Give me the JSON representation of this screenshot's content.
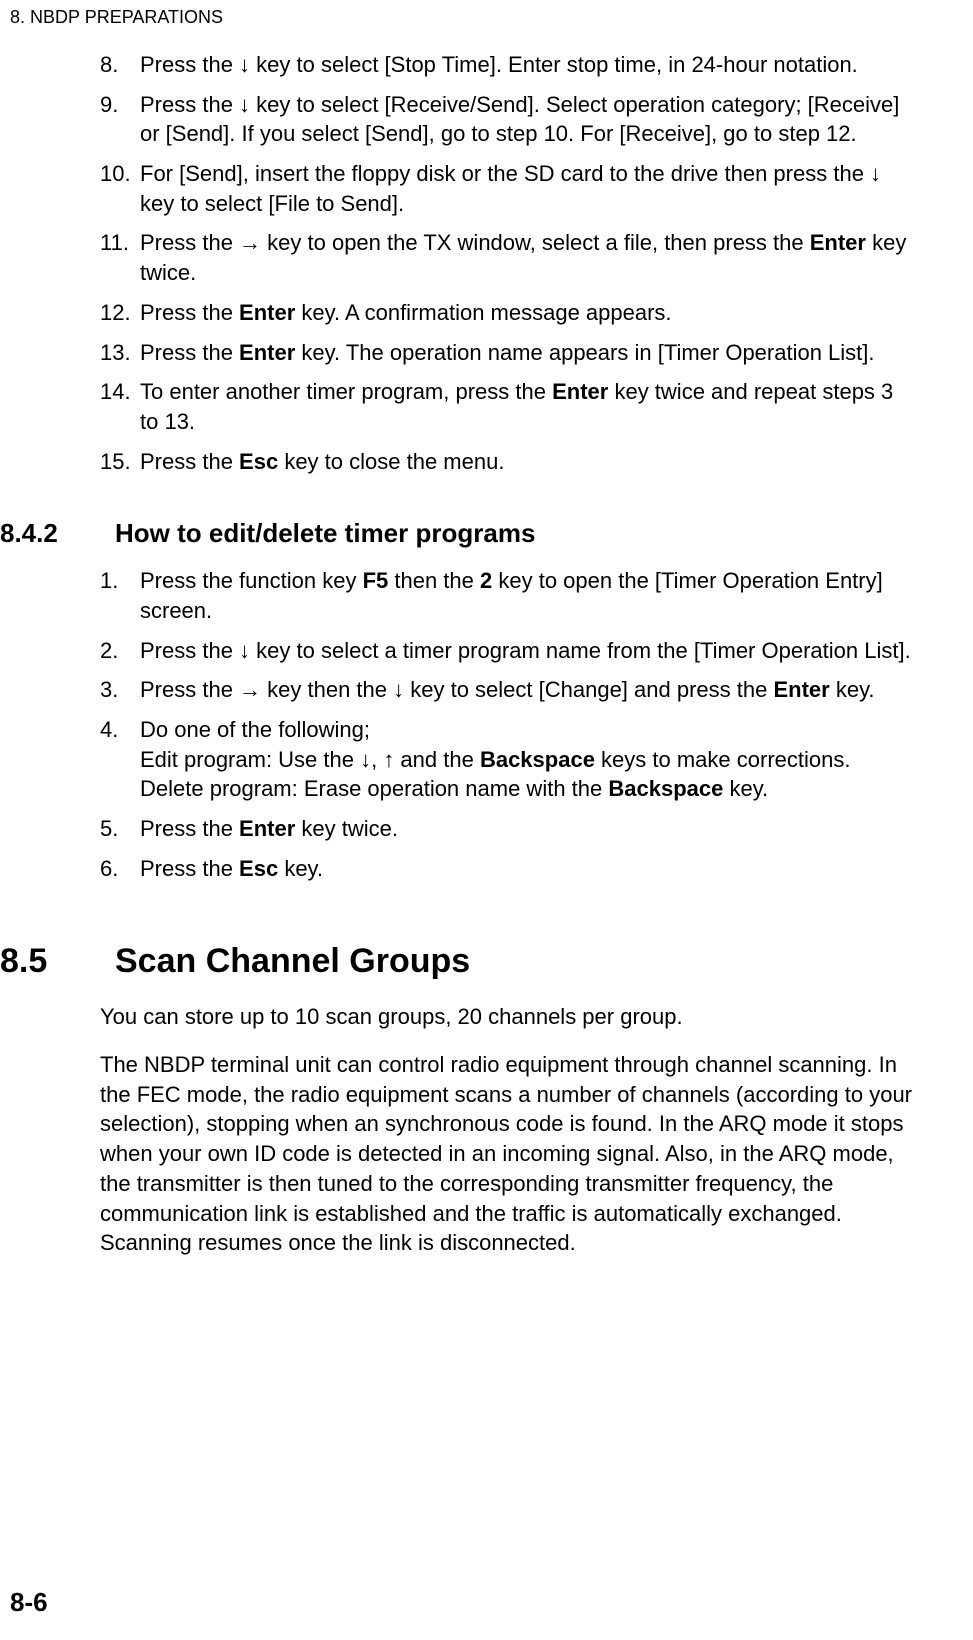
{
  "header": "8.  NBDP PREPARATIONS",
  "page_number": "8-6",
  "list1": {
    "items": [
      {
        "num": "8.",
        "html": "Press the ↓ key to select [Stop Time]. Enter stop time, in 24-hour notation."
      },
      {
        "num": "9.",
        "html": "Press the ↓ key to select [Receive/Send]. Select operation category; [Receive] or [Send]. If you select [Send], go to step 10. For [Receive], go to step 12."
      },
      {
        "num": "10.",
        "html": "For [Send], insert the floppy disk or the SD card to the drive then press the ↓ key to select [File to Send]."
      },
      {
        "num": "11.",
        "html": "Press the → key to open the TX window, select a file, then press the <b>Enter</b> key twice."
      },
      {
        "num": "12.",
        "html": "Press the <b>Enter</b> key. A confirmation message appears."
      },
      {
        "num": "13.",
        "html": "Press the <b>Enter</b> key. The operation name appears in [Timer Operation List]."
      },
      {
        "num": "14.",
        "html": "To enter another timer program, press the <b>Enter</b> key twice and repeat steps 3 to 13."
      },
      {
        "num": "15.",
        "html": "Press the <b>Esc</b> key to close the menu."
      }
    ]
  },
  "section842": {
    "num": "8.4.2",
    "title": "How to edit/delete timer programs",
    "items": [
      {
        "num": "1.",
        "html": "Press the function key <b>F5</b> then the <b>2</b> key to open the [Timer Operation Entry] screen."
      },
      {
        "num": "2.",
        "html": "Press the ↓ key to select a timer program name from the [Timer Operation List]."
      },
      {
        "num": "3.",
        "html": "Press the → key then the ↓ key to select [Change] and press the <b>Enter</b> key."
      },
      {
        "num": "4.",
        "html": "Do one of the following;<br>Edit program: Use the ↓, ↑ and the <b>Backspace</b> keys to make corrections.<br>Delete program: Erase operation name with the <b>Backspace</b> key."
      },
      {
        "num": "5.",
        "html": "Press the <b>Enter</b> key twice."
      },
      {
        "num": "6.",
        "html": "Press the <b>Esc</b> key."
      }
    ]
  },
  "section85": {
    "num": "8.5",
    "title": "Scan Channel Groups",
    "para1": "You can store up to 10 scan groups, 20 channels per group.",
    "para2": "The NBDP terminal unit can control radio equipment through channel scanning. In the FEC mode, the radio equipment scans a number of channels (according to your selection), stopping when an synchronous code is found. In the ARQ mode it stops when your own ID code is detected in an incoming signal. Also, in the ARQ mode, the transmitter is then tuned to the corresponding transmitter frequency, the communication link is established and the traffic is automatically exchanged. Scanning resumes once the link is disconnected."
  }
}
